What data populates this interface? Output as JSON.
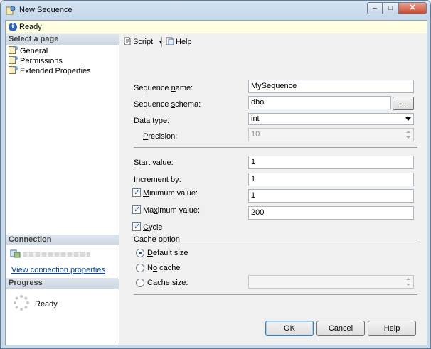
{
  "window": {
    "title": "New Sequence",
    "buttons": {
      "minimize": "–",
      "maximize": "□",
      "close": "✕"
    }
  },
  "status": {
    "icon": "info-icon",
    "text": "Ready"
  },
  "left_pane": {
    "select_page_header": "Select a page",
    "pages": [
      {
        "label": "General",
        "icon": "page-icon"
      },
      {
        "label": "Permissions",
        "icon": "page-icon"
      },
      {
        "label": "Extended Properties",
        "icon": "page-icon"
      }
    ],
    "connection_header": "Connection",
    "connection_link": "View connection properties",
    "progress_header": "Progress",
    "progress_text": "Ready"
  },
  "toolbar": {
    "script_label": "Script",
    "help_label": "Help"
  },
  "form": {
    "sequence_name": {
      "label_pre": "Sequence ",
      "label_u": "n",
      "label_post": "ame:",
      "value": "MySequence"
    },
    "sequence_schema": {
      "label_pre": "Sequence ",
      "label_u": "s",
      "label_post": "chema:",
      "value": "dbo",
      "browse": "..."
    },
    "data_type": {
      "label_pre": "",
      "label_u": "D",
      "label_post": "ata type:",
      "value": "int"
    },
    "precision": {
      "label_pre": "",
      "label_u": "P",
      "label_post": "recision:",
      "value": "10"
    },
    "start_value": {
      "label_pre": "",
      "label_u": "S",
      "label_post": "tart value:",
      "value": "1"
    },
    "increment_by": {
      "label_pre": "",
      "label_u": "I",
      "label_post": "ncrement by:",
      "value": "1"
    },
    "minimum_value": {
      "label_pre": "",
      "label_u": "M",
      "label_post": "inimum value:",
      "value": "1",
      "checked": true
    },
    "maximum_value": {
      "label_pre": "Ma",
      "label_u": "x",
      "label_post": "imum value:",
      "value": "200",
      "checked": true
    },
    "cycle": {
      "label_pre": "",
      "label_u": "C",
      "label_post": "ycle",
      "checked": true
    },
    "cache_option": {
      "header": "Cache option",
      "default_size": {
        "label_pre": "",
        "label_u": "D",
        "label_post": "efault size",
        "selected": true
      },
      "no_cache": {
        "label_pre": "N",
        "label_u": "o",
        "label_post": " cache",
        "selected": false
      },
      "cache_size": {
        "label_pre": "Ca",
        "label_u": "c",
        "label_post": "he size:",
        "selected": false,
        "value": ""
      }
    }
  },
  "buttons": {
    "ok": "OK",
    "cancel": "Cancel",
    "help": "Help"
  },
  "colors": {
    "status_bg": "#ffffe1",
    "link": "#0645ad",
    "window_frame": "#c9d9ea"
  }
}
